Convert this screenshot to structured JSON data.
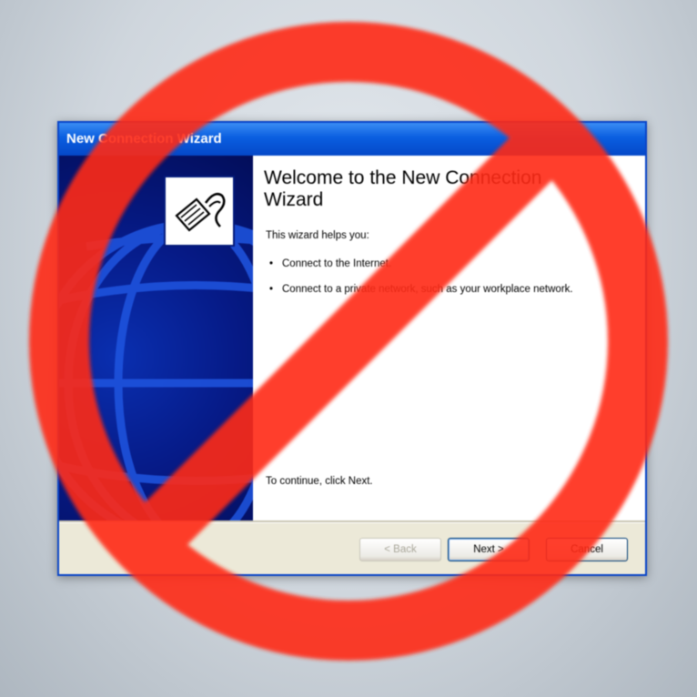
{
  "window": {
    "title": "New Connection Wizard"
  },
  "content": {
    "heading": "Welcome to the New Connection Wizard",
    "intro": "This wizard helps you:",
    "bullets": [
      "Connect to the Internet.",
      "Connect to a private network, such as your workplace network."
    ],
    "bullet_glyph": "•",
    "continue_text": "To continue, click Next."
  },
  "buttons": {
    "back": "< Back",
    "next": "Next >",
    "cancel": "Cancel"
  },
  "icons": {
    "wizard": "network-plug-icon",
    "overlay": "prohibition-sign-icon",
    "side_art": "globe-icon"
  },
  "colors": {
    "title_bar": "#0a5ee0",
    "side_panel": "#061a86",
    "prohibition_sign": "#ff2a14",
    "dialog_face": "#ece9d8"
  }
}
